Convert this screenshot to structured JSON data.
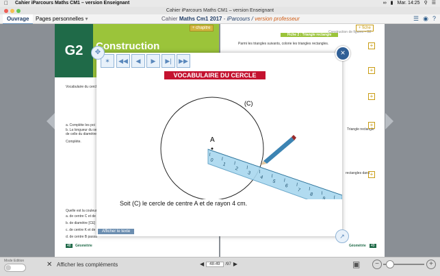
{
  "menubar": {
    "apple": "",
    "app_name": "Cahier iParcours Maths CM1 – version Enseignant",
    "clock": "Mar. 14:25"
  },
  "window": {
    "title": "Cahier iParcours Maths CM1 – version Enseignant"
  },
  "toolbar": {
    "tab_ouvrage": "Ouvrage",
    "tab_pages": "Pages personnelles",
    "doc_title_prefix": "Cahier",
    "doc_title_main": "Maths Cm1 2017",
    "doc_title_sep": " - ",
    "doc_title_sub": "iParcours /",
    "doc_title_prof": " version professeur"
  },
  "left_page": {
    "chapter": "G2",
    "heading": "Construction",
    "chapitre_btn": "+ chapitre",
    "ex_label": "Vocabulaire du cercle",
    "complete_line1": "a. Complète les poi",
    "complete_line2": "b. La longueur du se",
    "complete_line3": "de celle du diamètre",
    "completing": "Complète.",
    "q_couleur": "Quelle est la couleur",
    "q_a": "a. de centre C et de",
    "q_b": "b. de diamètre [CE]",
    "q_c": "c. de centre K et de",
    "q_d": "d. de centre B passa",
    "footer_num": "48",
    "footer_label": "Géométrie"
  },
  "right_page": {
    "fiche_btn": "+ fiche",
    "fiche_title": "Fiche 2 : Triangle rectangle",
    "fiche_sub": "Construction de figures • G2",
    "ex1": "Parmi les triangles suivants, colorie les triangles rectangles.",
    "tri_label": "Triangle rectangle",
    "rect_label": "rectangles  dans",
    "footer_label": "Géométrie",
    "footer_num": "49"
  },
  "popup": {
    "title": "VOCABULAIRE DU CERCLE",
    "circle_label": "(C)",
    "center_label": "A",
    "caption": "Soit (C) le cercle de centre A et de rayon 4 cm.",
    "show_text_btn": "Afficher le texte",
    "ruler_numbers": [
      "0",
      "1",
      "2",
      "3",
      "4",
      "5",
      "6",
      "7",
      "8",
      "9",
      "10"
    ]
  },
  "bottom": {
    "mode_edition": "Mode Edition",
    "afficher_complements": "Afficher les compléments",
    "page_current": "48-49",
    "page_total": "/97"
  }
}
